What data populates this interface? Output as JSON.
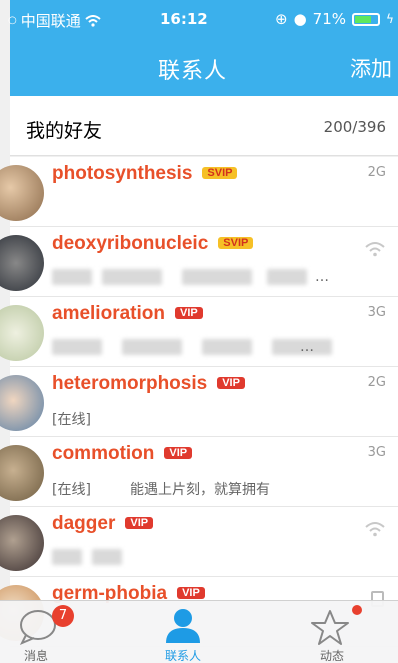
{
  "status_bar": {
    "carrier": "中国联通",
    "time": "16:12",
    "battery": "71%"
  },
  "nav": {
    "title": "联系人",
    "add_label": "添加"
  },
  "group": {
    "name": "我的好友",
    "count": "200/396"
  },
  "contacts": [
    {
      "name": "photosynthesis",
      "badge": "SVIP",
      "network": "2G",
      "status": ""
    },
    {
      "name": "deoxyribonucleic",
      "badge": "SVIP",
      "network": "wifi",
      "status": "…"
    },
    {
      "name": "amelioration",
      "badge": "VIP",
      "network": "3G",
      "status": "…"
    },
    {
      "name": "heteromorphosis",
      "badge": "VIP",
      "network": "2G",
      "status": "[在线]"
    },
    {
      "name": "commotion",
      "badge": "VIP",
      "network": "3G",
      "status": "[在线]",
      "signature": "能遇上片刻，就算拥有"
    },
    {
      "name": "dagger",
      "badge": "VIP",
      "network": "wifi",
      "status": ""
    },
    {
      "name": "germ-phobia",
      "badge": "VIP",
      "network": "phone",
      "status": ""
    }
  ],
  "tabs": [
    {
      "label": "消息",
      "badge": "7"
    },
    {
      "label": "联系人"
    },
    {
      "label": "动态"
    }
  ],
  "colors": {
    "accent": "#3bb0ec",
    "nickname": "#e8502a",
    "svip_badge": "#f6c026",
    "vip_badge": "#e03a2e",
    "notification": "#e8402e"
  }
}
